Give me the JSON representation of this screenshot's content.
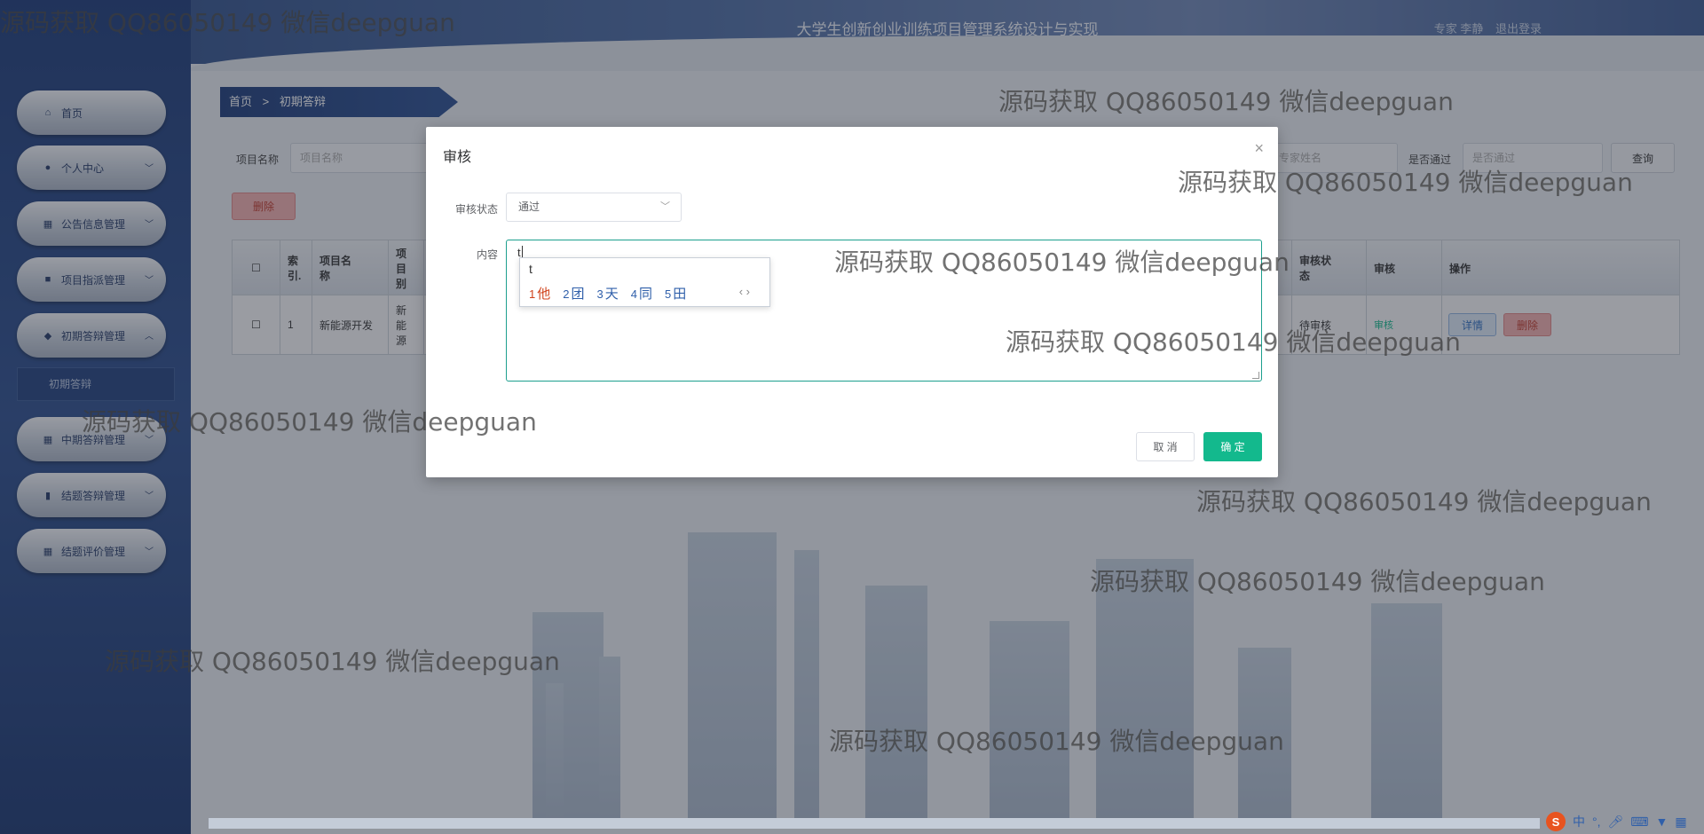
{
  "header": {
    "title": "大学生创新创业训练项目管理系统设计与实现",
    "user_label": "专家 李静",
    "logout_label": "退出登录"
  },
  "sidebar": {
    "items": [
      {
        "label": "首页",
        "icon": "home-icon"
      },
      {
        "label": "个人中心",
        "icon": "user-icon"
      },
      {
        "label": "公告信息管理",
        "icon": "grid-icon"
      },
      {
        "label": "项目指派管理",
        "icon": "camera-icon"
      },
      {
        "label": "初期答辩管理",
        "icon": "location-icon"
      },
      {
        "label": "中期答辩管理",
        "icon": "grid-icon"
      },
      {
        "label": "结题答辩管理",
        "icon": "chart-icon"
      },
      {
        "label": "结题评价管理",
        "icon": "grid-icon"
      }
    ],
    "sub_item": "初期答辩"
  },
  "breadcrumb": {
    "home": "首页",
    "sep": ">",
    "current": "初期答辩"
  },
  "search": {
    "project_name_label": "项目名称",
    "project_name_placeholder": "项目名称",
    "expert_placeholder": "专家姓名",
    "passed_label": "是否通过",
    "passed_placeholder": "是否通过",
    "query_label": "查询"
  },
  "toolbar": {
    "delete_label": "删除"
  },
  "table": {
    "headers": [
      "索引",
      "项目名称",
      "项目类别",
      "审核状态",
      "审核",
      "操作"
    ],
    "header_display": {
      "index": "索\n引.",
      "name": "项目名\n称",
      "category": "项目\n别",
      "status": "审核状\n态",
      "review": "审核",
      "ops": "操作"
    },
    "rows": [
      {
        "index": "1",
        "name": "新能源开发",
        "category": "新能源",
        "status": "待审核",
        "review": "审核",
        "detail": "详情",
        "delete": "删除"
      }
    ]
  },
  "dialog": {
    "title": "审核",
    "status_label": "审核状态",
    "status_value": "通过",
    "content_label": "内容",
    "content_value": "t",
    "cancel_label": "取 消",
    "ok_label": "确 定"
  },
  "ime": {
    "composition": "t",
    "candidates": [
      {
        "num": "1",
        "text": "他"
      },
      {
        "num": "2",
        "text": "团"
      },
      {
        "num": "3",
        "text": "天"
      },
      {
        "num": "4",
        "text": "同"
      },
      {
        "num": "5",
        "text": "田"
      }
    ],
    "nav": "‹ ›"
  },
  "watermark": "源码获取 QQ86050149 微信deepguan",
  "taskbar": {
    "ime_mode": "中",
    "punct": "°,",
    "logo": "S"
  },
  "colors": {
    "accent": "#13b98d",
    "sidebar": "#1c3a78",
    "danger": "#c0392b",
    "link": "#2f6fc2"
  }
}
